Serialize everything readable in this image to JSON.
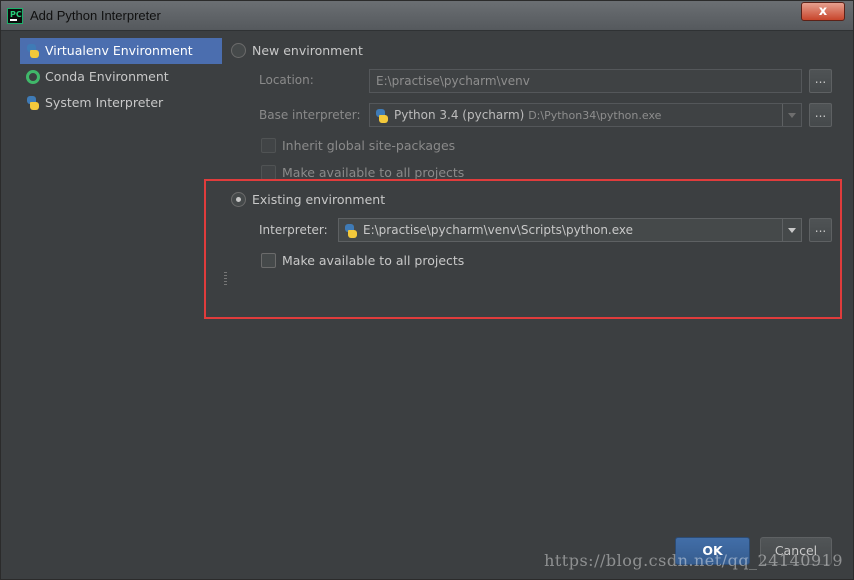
{
  "window": {
    "title": "Add Python Interpreter",
    "app_icon_text": "PC",
    "close_label": "x"
  },
  "sidebar": {
    "items": [
      {
        "label": "Virtualenv Environment",
        "icon": "python-icon",
        "selected": true
      },
      {
        "label": "Conda Environment",
        "icon": "conda-icon",
        "selected": false
      },
      {
        "label": "System Interpreter",
        "icon": "python-icon",
        "selected": false
      }
    ]
  },
  "new_env": {
    "radio_label": "New environment",
    "selected": false,
    "location_label": "Location:",
    "location_value": "E:\\practise\\pycharm\\venv",
    "base_label": "Base interpreter:",
    "base_value": "Python 3.4 (pycharm)",
    "base_path": "D:\\Python34\\python.exe",
    "inherit_label": "Inherit global site-packages",
    "make_available_label": "Make available to all projects"
  },
  "existing_env": {
    "radio_label": "Existing environment",
    "selected": true,
    "interpreter_label": "Interpreter:",
    "interpreter_value": "E:\\practise\\pycharm\\venv\\Scripts\\python.exe",
    "make_available_label": "Make available to all projects"
  },
  "browse_label": "...",
  "footer": {
    "ok_label": "OK",
    "cancel_label": "Cancel"
  },
  "watermark": "https://blog.csdn.net/qq_24140919",
  "colors": {
    "background": "#3c3f41",
    "selection": "#4b6eaf",
    "highlight_box": "#e03c3c",
    "ok_button": "#365d8f"
  }
}
